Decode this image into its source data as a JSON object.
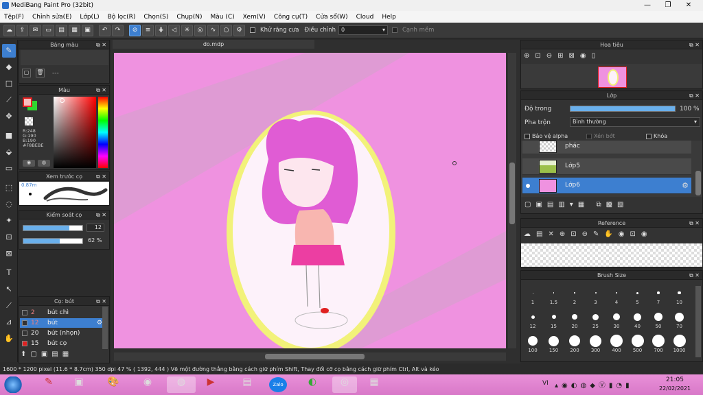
{
  "app": {
    "title": "MediBang Paint Pro (32bit)",
    "win_min": "—",
    "win_max": "❐",
    "win_close": "✕"
  },
  "menu": [
    "Tệp(F)",
    "Chỉnh sửa(E)",
    "Lớp(L)",
    "Bộ lọc(R)",
    "Chọn(S)",
    "Chụp(N)",
    "Màu (C)",
    "Xem(V)",
    "Công cụ(T)",
    "Cửa sổ(W)",
    "Cloud",
    "Help"
  ],
  "toolbar": {
    "antialias_label": "Khử răng cưa",
    "adjust_label": "Điều chỉnh",
    "adjust_value": "0",
    "edge_label": "Cạnh mềm"
  },
  "doc": {
    "tab": "do.mdp"
  },
  "panels": {
    "palette": {
      "title": "Bảng màu",
      "empty": "---"
    },
    "color": {
      "title": "Màu",
      "r": "R:248",
      "g": "G:190",
      "b": "B:190",
      "hex": "#F8BEBE",
      "primary": "#f8bebe",
      "secondary": "#2fd82f"
    },
    "stroke_preview": {
      "title": "Xem trước cọ",
      "size": "0.87m"
    },
    "brush_control": {
      "title": "Kiểm soát cọ",
      "size": "12",
      "opacity": "62 %",
      "size_pct": 0.78,
      "opacity_pct": 0.62
    },
    "brush": {
      "title": "Cọ: bút",
      "items": [
        {
          "num": "2",
          "name": "bút chì",
          "color": "#333333"
        },
        {
          "num": "12",
          "name": "bút",
          "color": "#333333"
        },
        {
          "num": "20",
          "name": "bút (nhọn)",
          "color": "#333333"
        },
        {
          "num": "15",
          "name": "bút cọ",
          "color": "#e02020"
        }
      ]
    },
    "navigator": {
      "title": "Hoa tiêu"
    },
    "layer": {
      "title": "Lớp",
      "opacity_label": "Độ trong",
      "opacity_value": "100 %",
      "opacity_pct": 1.0,
      "blend_label": "Pha trộn",
      "blend_value": "Bình thường",
      "protect_alpha": "Bảo vệ alpha",
      "clipping": "Xén bớt",
      "lock": "Khóa",
      "items": [
        {
          "name": "phác"
        },
        {
          "name": "Lớp5"
        },
        {
          "name": "Lớp6"
        }
      ]
    },
    "reference": {
      "title": "Reference"
    },
    "brush_size": {
      "title": "Brush Size",
      "sizes": [
        "1",
        "1.5",
        "2",
        "3",
        "4",
        "5",
        "7",
        "10",
        "12",
        "15",
        "20",
        "25",
        "30",
        "40",
        "50",
        "70",
        "100",
        "150",
        "200",
        "300",
        "400",
        "500",
        "700",
        "1000"
      ]
    }
  },
  "status": {
    "text": "1600 * 1200 pixel   (11.6 * 8.7cm)   350 dpi   47 %   ( 1392, 444 )   Vẽ một đường thẳng bằng cách giữ phím Shift, Thay đổi cỡ cọ bằng cách giữ phím Ctrl, Alt và kéo"
  },
  "taskbar": {
    "lang": "VI",
    "time": "21:05",
    "date": "22/02/2021",
    "zalo": "Zalo"
  }
}
